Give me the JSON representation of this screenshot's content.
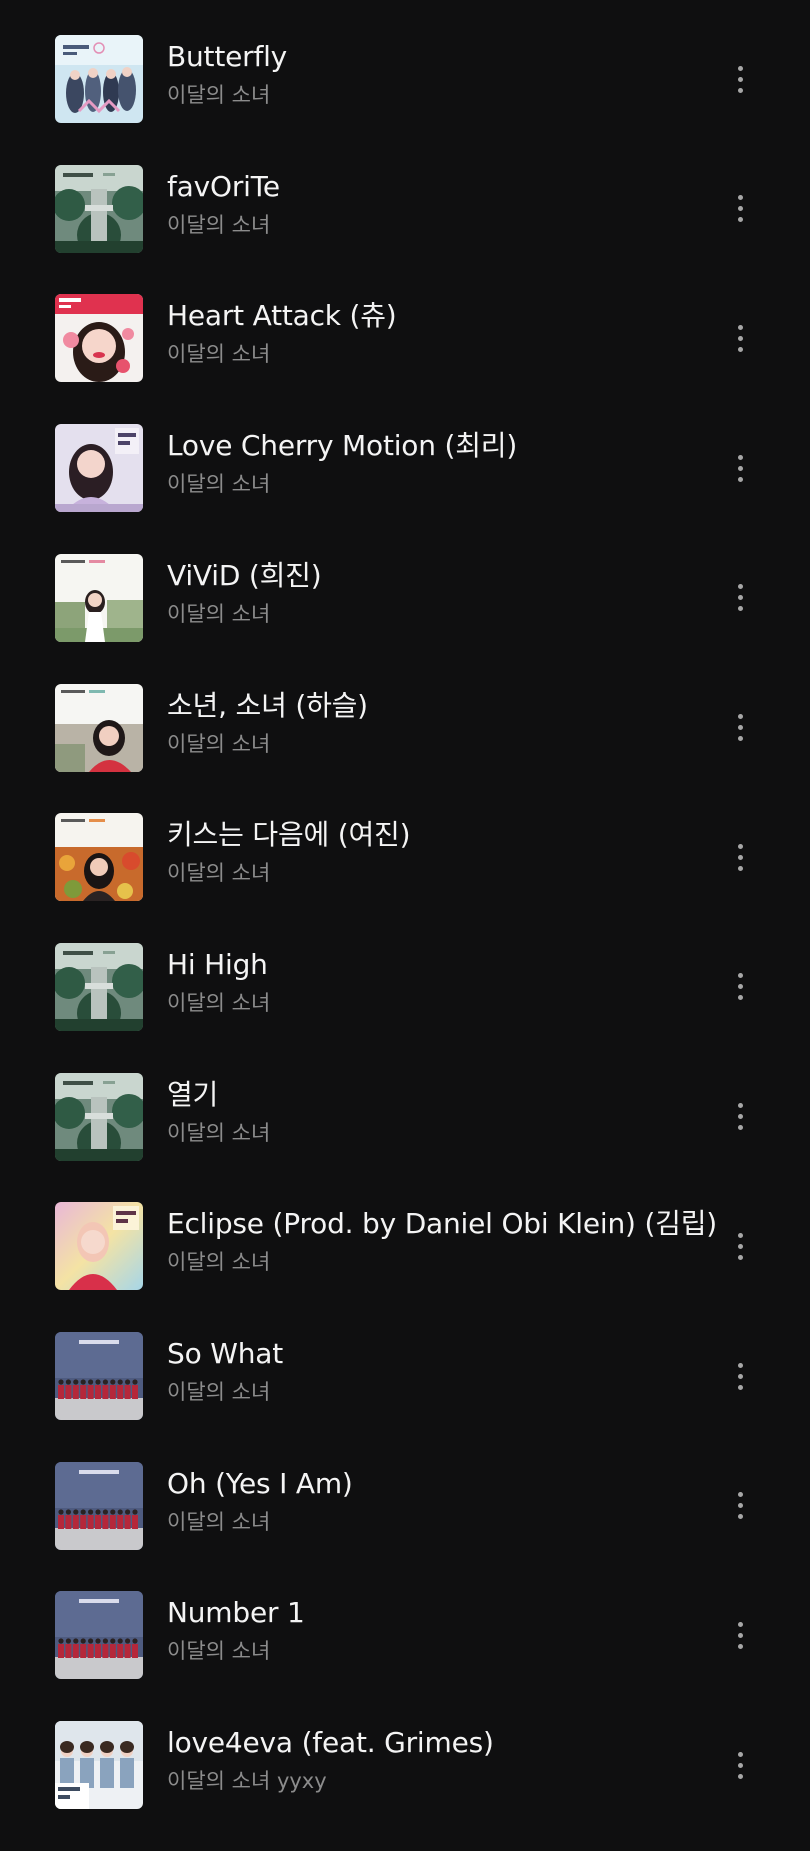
{
  "tracks": [
    {
      "title": "Butterfly",
      "artist": "이달의 소녀",
      "cover_icon": "album-cover-butterfly"
    },
    {
      "title": "favOriTe",
      "artist": "이달의 소녀",
      "cover_icon": "album-cover-tree"
    },
    {
      "title": "Heart Attack (츄)",
      "artist": "이달의 소녀",
      "cover_icon": "album-cover-chuu"
    },
    {
      "title": "Love Cherry Motion (최리)",
      "artist": "이달의 소녀",
      "cover_icon": "album-cover-choerry"
    },
    {
      "title": "ViViD (희진)",
      "artist": "이달의 소녀",
      "cover_icon": "album-cover-heejin"
    },
    {
      "title": "소년, 소녀 (하슬)",
      "artist": "이달의 소녀",
      "cover_icon": "album-cover-haseul"
    },
    {
      "title": "키스는 다음에 (여진)",
      "artist": "이달의 소녀",
      "cover_icon": "album-cover-yeojin"
    },
    {
      "title": "Hi High",
      "artist": "이달의 소녀",
      "cover_icon": "album-cover-tree"
    },
    {
      "title": "열기",
      "artist": "이달의 소녀",
      "cover_icon": "album-cover-tree"
    },
    {
      "title": "Eclipse (Prod. by Daniel Obi Klein) (김립)",
      "artist": "이달의 소녀",
      "cover_icon": "album-cover-kimlip"
    },
    {
      "title": "So What",
      "artist": "이달의 소녀",
      "cover_icon": "album-cover-group"
    },
    {
      "title": "Oh (Yes I Am)",
      "artist": "이달의 소녀",
      "cover_icon": "album-cover-group"
    },
    {
      "title": "Number 1",
      "artist": "이달의 소녀",
      "cover_icon": "album-cover-group"
    },
    {
      "title": "love4eva (feat. Grimes)",
      "artist": "이달의 소녀 yyxy",
      "cover_icon": "album-cover-yyxy"
    }
  ],
  "more_icon": "more-vertical-icon",
  "colors": {
    "background": "#0f0f10",
    "title_text": "#f4f4f4",
    "artist_text": "#8c8c8c",
    "more_dots": "#a7a7a7"
  }
}
